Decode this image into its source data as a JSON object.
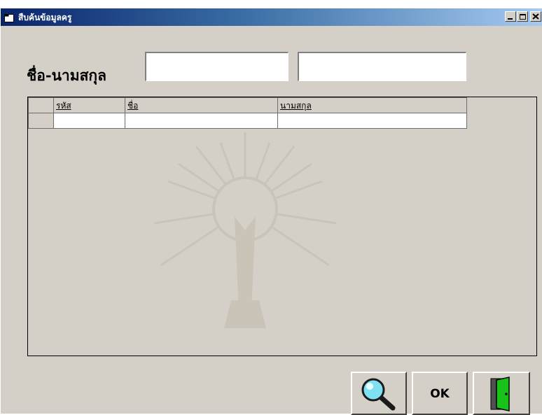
{
  "window": {
    "title": "สืบค้นข้อมูลครู",
    "controls": [
      "minimize",
      "maximize",
      "close"
    ]
  },
  "form": {
    "name_label": "ชื่อ-นามสกุล",
    "first_name_value": "",
    "last_name_value": ""
  },
  "grid": {
    "columns": [
      "รหัส",
      "ชื่อ",
      "นามสกุล"
    ],
    "rows": [
      [
        "",
        "",
        ""
      ]
    ]
  },
  "buttons": {
    "search_icon": "magnifier-icon",
    "ok_label": "OK",
    "exit_icon": "door-exit-icon"
  },
  "colors": {
    "window_face": "#d4d0c8",
    "title_start": "#0a246a",
    "title_end": "#a6caf0",
    "door_green": "#19c119"
  }
}
